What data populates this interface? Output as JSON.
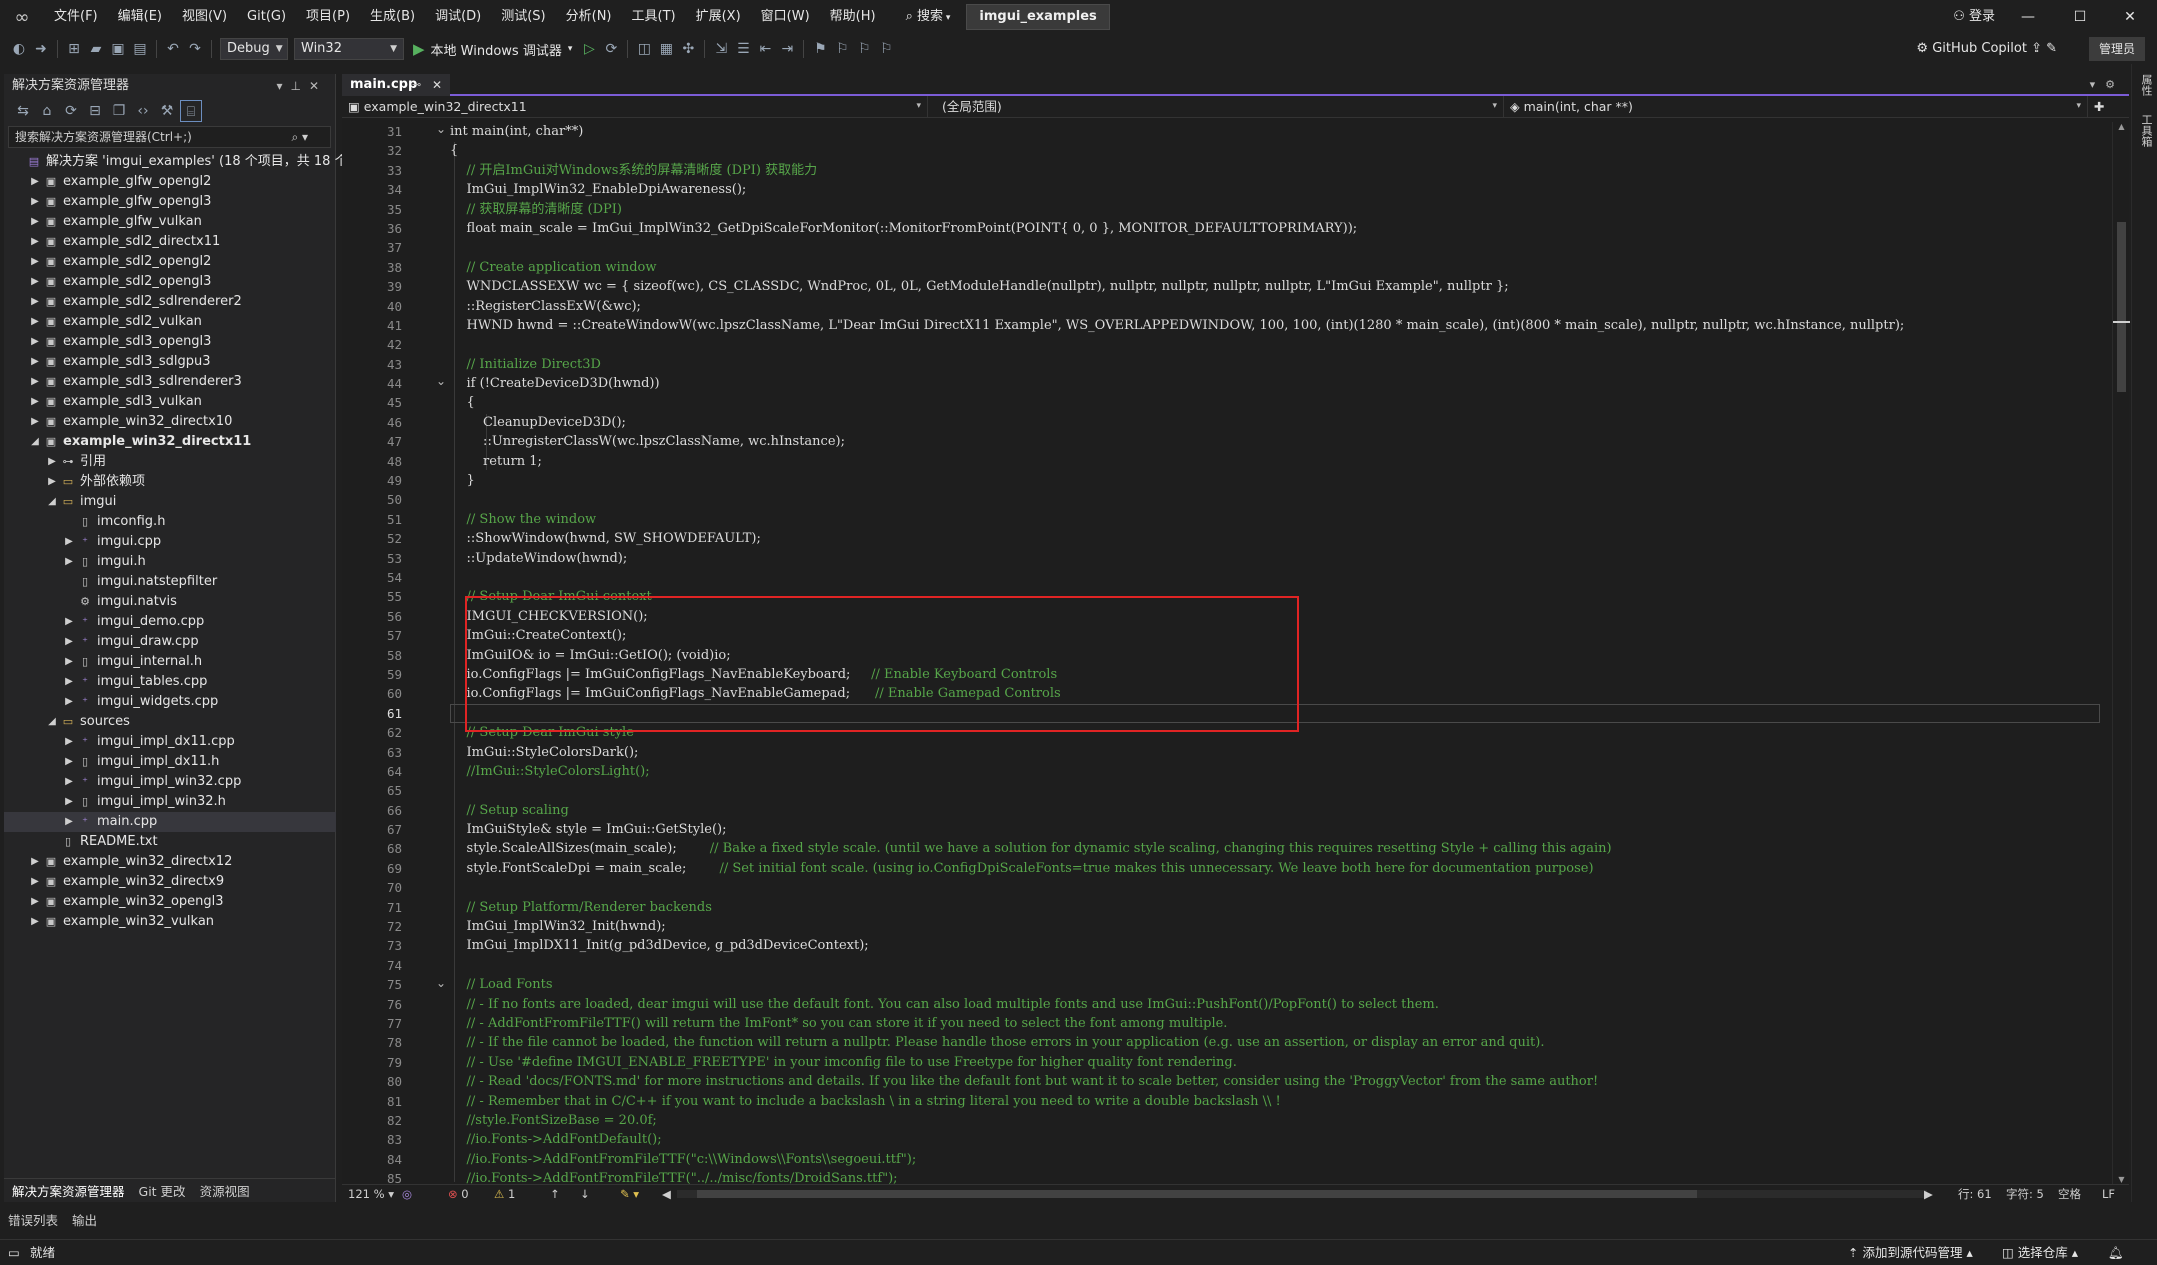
{
  "menubar": {
    "items": [
      "文件(F)",
      "编辑(E)",
      "视图(V)",
      "Git(G)",
      "项目(P)",
      "生成(B)",
      "调试(D)",
      "测试(S)",
      "分析(N)",
      "工具(T)",
      "扩展(X)",
      "窗口(W)",
      "帮助(H)"
    ],
    "search_label": "搜索",
    "solution_name": "imgui_examples",
    "login_label": "登录"
  },
  "toolbar": {
    "config_label": "Debug",
    "platform_label": "Win32",
    "run_label": "本地 Windows 调试器",
    "copilot_label": "GitHub Copilot",
    "admin_label": "管理员"
  },
  "explorer": {
    "title": "解决方案资源管理器",
    "search_placeholder": "搜索解决方案资源管理器(Ctrl+;)",
    "items": [
      {
        "depth": 0,
        "chevron": "",
        "icon": "solution",
        "label": "解决方案 'imgui_examples' (18 个项目，共 18 个)"
      },
      {
        "depth": 1,
        "chevron": "▶",
        "icon": "project",
        "label": "example_glfw_opengl2"
      },
      {
        "depth": 1,
        "chevron": "▶",
        "icon": "project",
        "label": "example_glfw_opengl3"
      },
      {
        "depth": 1,
        "chevron": "▶",
        "icon": "project",
        "label": "example_glfw_vulkan"
      },
      {
        "depth": 1,
        "chevron": "▶",
        "icon": "project",
        "label": "example_sdl2_directx11"
      },
      {
        "depth": 1,
        "chevron": "▶",
        "icon": "project",
        "label": "example_sdl2_opengl2"
      },
      {
        "depth": 1,
        "chevron": "▶",
        "icon": "project",
        "label": "example_sdl2_opengl3"
      },
      {
        "depth": 1,
        "chevron": "▶",
        "icon": "project",
        "label": "example_sdl2_sdlrenderer2"
      },
      {
        "depth": 1,
        "chevron": "▶",
        "icon": "project",
        "label": "example_sdl2_vulkan"
      },
      {
        "depth": 1,
        "chevron": "▶",
        "icon": "project",
        "label": "example_sdl3_opengl3"
      },
      {
        "depth": 1,
        "chevron": "▶",
        "icon": "project",
        "label": "example_sdl3_sdlgpu3"
      },
      {
        "depth": 1,
        "chevron": "▶",
        "icon": "project",
        "label": "example_sdl3_sdlrenderer3"
      },
      {
        "depth": 1,
        "chevron": "▶",
        "icon": "project",
        "label": "example_sdl3_vulkan"
      },
      {
        "depth": 1,
        "chevron": "▶",
        "icon": "project",
        "label": "example_win32_directx10"
      },
      {
        "depth": 1,
        "chevron": "◢",
        "icon": "project",
        "label": "example_win32_directx11",
        "bold": true
      },
      {
        "depth": 2,
        "chevron": "▶",
        "icon": "ref",
        "label": "引用"
      },
      {
        "depth": 2,
        "chevron": "▶",
        "icon": "folder",
        "label": "外部依赖项"
      },
      {
        "depth": 2,
        "chevron": "◢",
        "icon": "folder",
        "label": "imgui"
      },
      {
        "depth": 3,
        "chevron": "",
        "icon": "header",
        "label": "imconfig.h"
      },
      {
        "depth": 3,
        "chevron": "▶",
        "icon": "cpp",
        "label": "imgui.cpp"
      },
      {
        "depth": 3,
        "chevron": "▶",
        "icon": "header",
        "label": "imgui.h"
      },
      {
        "depth": 3,
        "chevron": "",
        "icon": "file",
        "label": "imgui.natstepfilter"
      },
      {
        "depth": 3,
        "chevron": "",
        "icon": "natvis",
        "label": "imgui.natvis"
      },
      {
        "depth": 3,
        "chevron": "▶",
        "icon": "cpp",
        "label": "imgui_demo.cpp"
      },
      {
        "depth": 3,
        "chevron": "▶",
        "icon": "cpp",
        "label": "imgui_draw.cpp"
      },
      {
        "depth": 3,
        "chevron": "▶",
        "icon": "header",
        "label": "imgui_internal.h"
      },
      {
        "depth": 3,
        "chevron": "▶",
        "icon": "cpp",
        "label": "imgui_tables.cpp"
      },
      {
        "depth": 3,
        "chevron": "▶",
        "icon": "cpp",
        "label": "imgui_widgets.cpp"
      },
      {
        "depth": 2,
        "chevron": "◢",
        "icon": "folder",
        "label": "sources"
      },
      {
        "depth": 3,
        "chevron": "▶",
        "icon": "cpp",
        "label": "imgui_impl_dx11.cpp"
      },
      {
        "depth": 3,
        "chevron": "▶",
        "icon": "header",
        "label": "imgui_impl_dx11.h"
      },
      {
        "depth": 3,
        "chevron": "▶",
        "icon": "cpp",
        "label": "imgui_impl_win32.cpp"
      },
      {
        "depth": 3,
        "chevron": "▶",
        "icon": "header",
        "label": "imgui_impl_win32.h"
      },
      {
        "depth": 3,
        "chevron": "▶",
        "icon": "cpp",
        "label": "main.cpp",
        "selected": true
      },
      {
        "depth": 2,
        "chevron": "",
        "icon": "file",
        "label": "README.txt"
      },
      {
        "depth": 1,
        "chevron": "▶",
        "icon": "project",
        "label": "example_win32_directx12"
      },
      {
        "depth": 1,
        "chevron": "▶",
        "icon": "project",
        "label": "example_win32_directx9"
      },
      {
        "depth": 1,
        "chevron": "▶",
        "icon": "project",
        "label": "example_win32_opengl3"
      },
      {
        "depth": 1,
        "chevron": "▶",
        "icon": "project",
        "label": "example_win32_vulkan"
      }
    ],
    "tabs": [
      "解决方案资源管理器",
      "Git 更改",
      "资源视图"
    ]
  },
  "editor": {
    "tab_label": "main.cpp",
    "nav_project": "example_win32_directx11",
    "nav_scope": "(全局范围)",
    "nav_function": "main(int, char **)",
    "first_line": 31,
    "current_line": 61,
    "lines": [
      "int main(int, char**)",
      "{",
      "    // 开启ImGui对Windows系统的屏幕清晰度 (DPI) 获取能力",
      "    ImGui_ImplWin32_EnableDpiAwareness();",
      "    // 获取屏幕的清晰度 (DPI)",
      "    float main_scale = ImGui_ImplWin32_GetDpiScaleForMonitor(::MonitorFromPoint(POINT{ 0, 0 }, MONITOR_DEFAULTTOPRIMARY));",
      "",
      "    // Create application window",
      "    WNDCLASSEXW wc = { sizeof(wc), CS_CLASSDC, WndProc, 0L, 0L, GetModuleHandle(nullptr), nullptr, nullptr, nullptr, nullptr, L\"ImGui Example\", nullptr };",
      "    ::RegisterClassExW(&wc);",
      "    HWND hwnd = ::CreateWindowW(wc.lpszClassName, L\"Dear ImGui DirectX11 Example\", WS_OVERLAPPEDWINDOW, 100, 100, (int)(1280 * main_scale), (int)(800 * main_scale), nullptr, nullptr, wc.hInstance, nullptr);",
      "",
      "    // Initialize Direct3D",
      "    if (!CreateDeviceD3D(hwnd))",
      "    {",
      "        CleanupDeviceD3D();",
      "        ::UnregisterClassW(wc.lpszClassName, wc.hInstance);",
      "        return 1;",
      "    }",
      "",
      "    // Show the window",
      "    ::ShowWindow(hwnd, SW_SHOWDEFAULT);",
      "    ::UpdateWindow(hwnd);",
      "",
      "    // Setup Dear ImGui context",
      "    IMGUI_CHECKVERSION();",
      "    ImGui::CreateContext();",
      "    ImGuiIO& io = ImGui::GetIO(); (void)io;",
      "    io.ConfigFlags |= ImGuiConfigFlags_NavEnableKeyboard;     // Enable Keyboard Controls",
      "    io.ConfigFlags |= ImGuiConfigFlags_NavEnableGamepad;      // Enable Gamepad Controls",
      "",
      "    // Setup Dear ImGui style",
      "    ImGui::StyleColorsDark();",
      "    //ImGui::StyleColorsLight();",
      "",
      "    // Setup scaling",
      "    ImGuiStyle& style = ImGui::GetStyle();",
      "    style.ScaleAllSizes(main_scale);        // Bake a fixed style scale. (until we have a solution for dynamic style scaling, changing this requires resetting Style + calling this again)",
      "    style.FontScaleDpi = main_scale;        // Set initial font scale. (using io.ConfigDpiScaleFonts=true makes this unnecessary. We leave both here for documentation purpose)",
      "",
      "    // Setup Platform/Renderer backends",
      "    ImGui_ImplWin32_Init(hwnd);",
      "    ImGui_ImplDX11_Init(g_pd3dDevice, g_pd3dDeviceContext);",
      "",
      "    // Load Fonts",
      "    // - If no fonts are loaded, dear imgui will use the default font. You can also load multiple fonts and use ImGui::PushFont()/PopFont() to select them.",
      "    // - AddFontFromFileTTF() will return the ImFont* so you can store it if you need to select the font among multiple.",
      "    // - If the file cannot be loaded, the function will return a nullptr. Please handle those errors in your application (e.g. use an assertion, or display an error and quit).",
      "    // - Use '#define IMGUI_ENABLE_FREETYPE' in your imconfig file to use Freetype for higher quality font rendering.",
      "    // - Read 'docs/FONTS.md' for more instructions and details. If you like the default font but want it to scale better, consider using the 'ProggyVector' from the same author!",
      "    // - Remember that in C/C++ if you want to include a backslash \\ in a string literal you need to write a double backslash \\\\ !",
      "    //style.FontSizeBase = 20.0f;",
      "    //io.Fonts->AddFontDefault();",
      "    //io.Fonts->AddFontFromFileTTF(\"c:\\\\Windows\\\\Fonts\\\\segoeui.ttf\");",
      "    //io.Fonts->AddFontFromFileTTF(\"../../misc/fonts/DroidSans.ttf\");"
    ]
  },
  "editor_status": {
    "zoom": "121 %",
    "errors": "0",
    "warnings": "1",
    "line": "行: 61",
    "char": "字符: 5",
    "mode": "空格",
    "eol": "LF"
  },
  "bottom_tabs": [
    "错误列表",
    "输出"
  ],
  "statusbar": {
    "ready": "就绪",
    "add_source": "添加到源代码管理",
    "select_repo": "选择仓库"
  },
  "right_strip": [
    "属性",
    "工具箱"
  ],
  "colors": {
    "accent": "#7b5cd6",
    "comment": "#57a64a",
    "highlight_box": "#e02424"
  }
}
